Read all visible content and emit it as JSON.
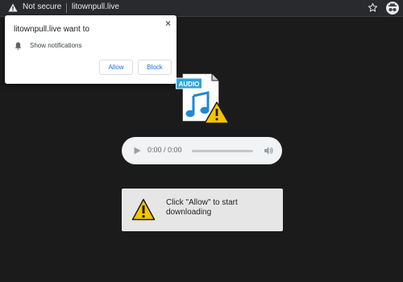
{
  "browser": {
    "security_label": "Not secure",
    "url": "litownpull.live"
  },
  "notification_prompt": {
    "title": "litownpull.live want to",
    "close_glyph": "×",
    "permission_label": "Show notifications",
    "allow_label": "Allow",
    "block_label": "Block"
  },
  "file_icon": {
    "badge_text": "AUDIO"
  },
  "audio_player": {
    "time": "0:00 / 0:00",
    "progress": 0
  },
  "notice": {
    "message": "Click \"Allow\" to start downloading"
  },
  "colors": {
    "toolbar_bg": "#292a2d",
    "page_bg": "#1b1b1b",
    "accent_blue": "#1a73e8",
    "warning_yellow": "#f5c400"
  }
}
